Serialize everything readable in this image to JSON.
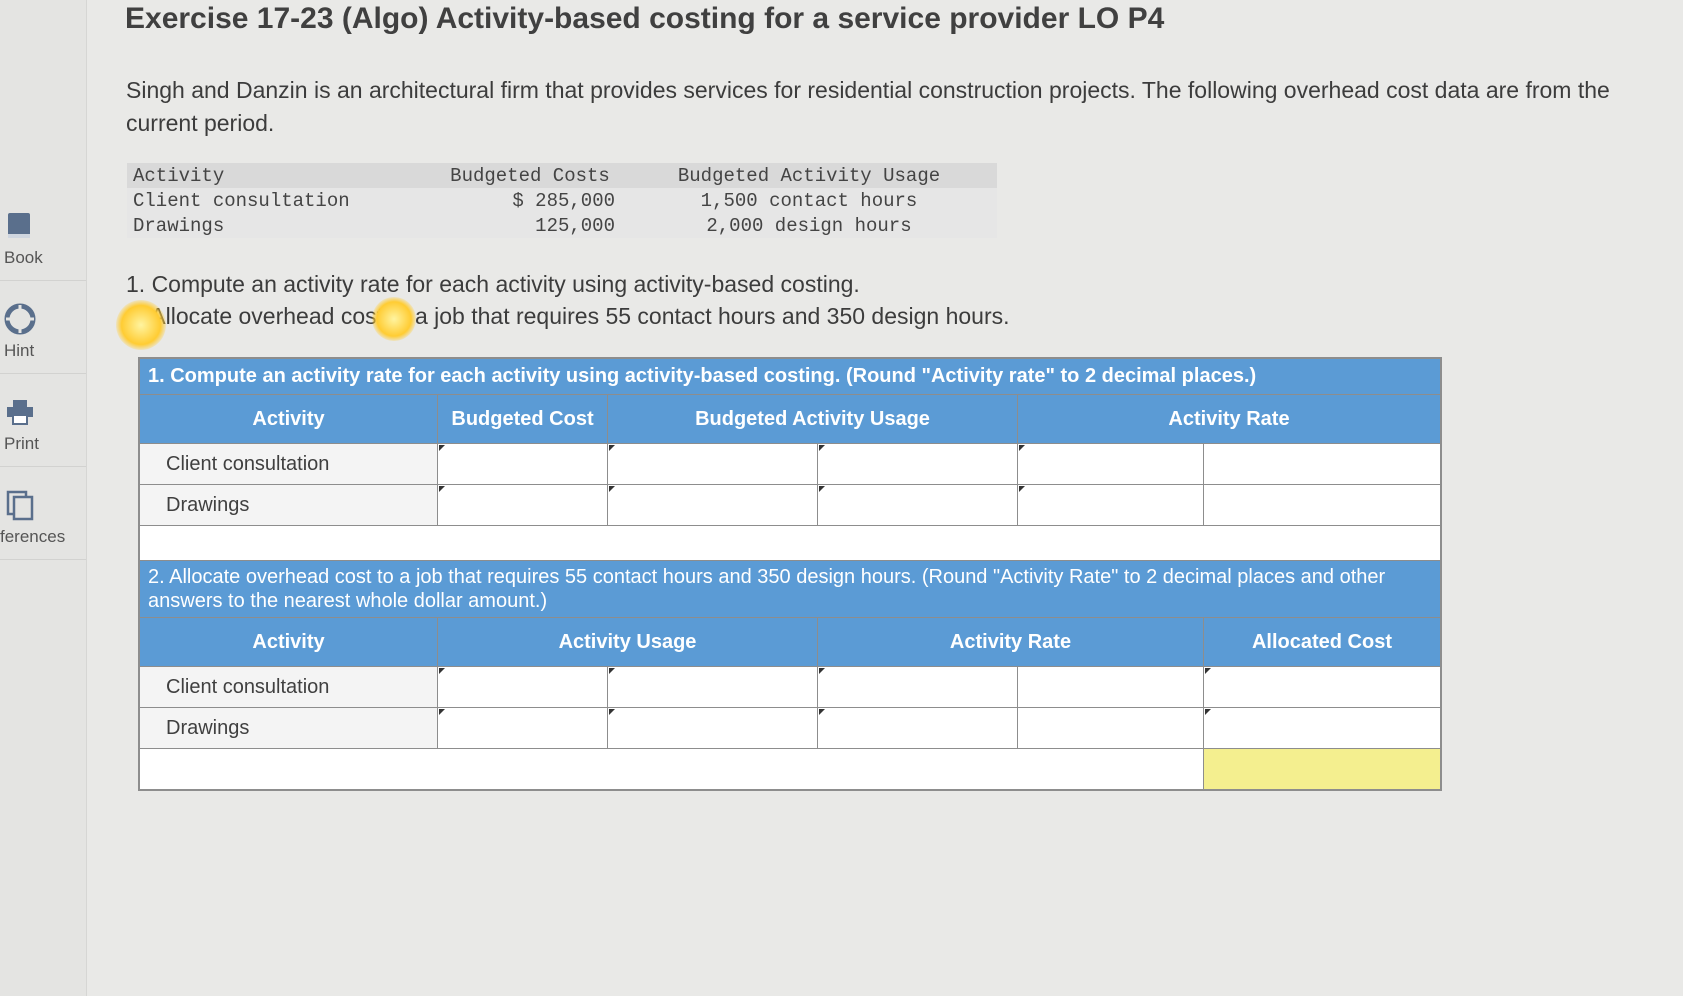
{
  "sidebar": {
    "items": [
      {
        "label": "Book",
        "icon": "book-icon"
      },
      {
        "label": "Hint",
        "icon": "lifebuoy-icon"
      },
      {
        "label": "Print",
        "icon": "printer-icon"
      },
      {
        "label": "ferences",
        "icon": "copy-icon"
      }
    ]
  },
  "title": "Exercise 17-23 (Algo) Activity-based costing for a service provider LO P4",
  "intro": "Singh and Danzin is an architectural firm that provides services for residential construction projects. The following overhead cost data are from the current period.",
  "given_table": {
    "headers": [
      "Activity",
      "Budgeted Costs",
      "Budgeted Activity Usage"
    ],
    "rows": [
      {
        "activity": "Client consultation",
        "cost": "$ 285,000",
        "usage": "1,500 contact hours"
      },
      {
        "activity": "Drawings",
        "cost": "125,000",
        "usage": "2,000 design hours"
      }
    ]
  },
  "instructions": {
    "line1": "1. Compute an activity rate for each activity using activity-based costing.",
    "line2": "2. Allocate overhead cost to a job that requires 55 contact hours and 350 design hours."
  },
  "part1": {
    "title": "1. Compute an activity rate for each activity using activity-based costing. (Round \"Activity rate\" to 2 decimal places.)",
    "headers": [
      "Activity",
      "Budgeted Cost",
      "Budgeted Activity Usage",
      "Activity Rate"
    ],
    "rows": [
      "Client consultation",
      "Drawings"
    ]
  },
  "part2": {
    "title": "2. Allocate overhead cost to a job that requires 55 contact hours and 350 design hours. (Round \"Activity Rate\" to 2 decimal places and other answers to the nearest whole dollar amount.)",
    "headers": [
      "Activity",
      "Activity Usage",
      "Activity Rate",
      "Allocated Cost"
    ],
    "rows": [
      "Client consultation",
      "Drawings"
    ]
  },
  "colors": {
    "header_blue": "#5b9bd5",
    "total_yellow": "#f4ef8f"
  }
}
